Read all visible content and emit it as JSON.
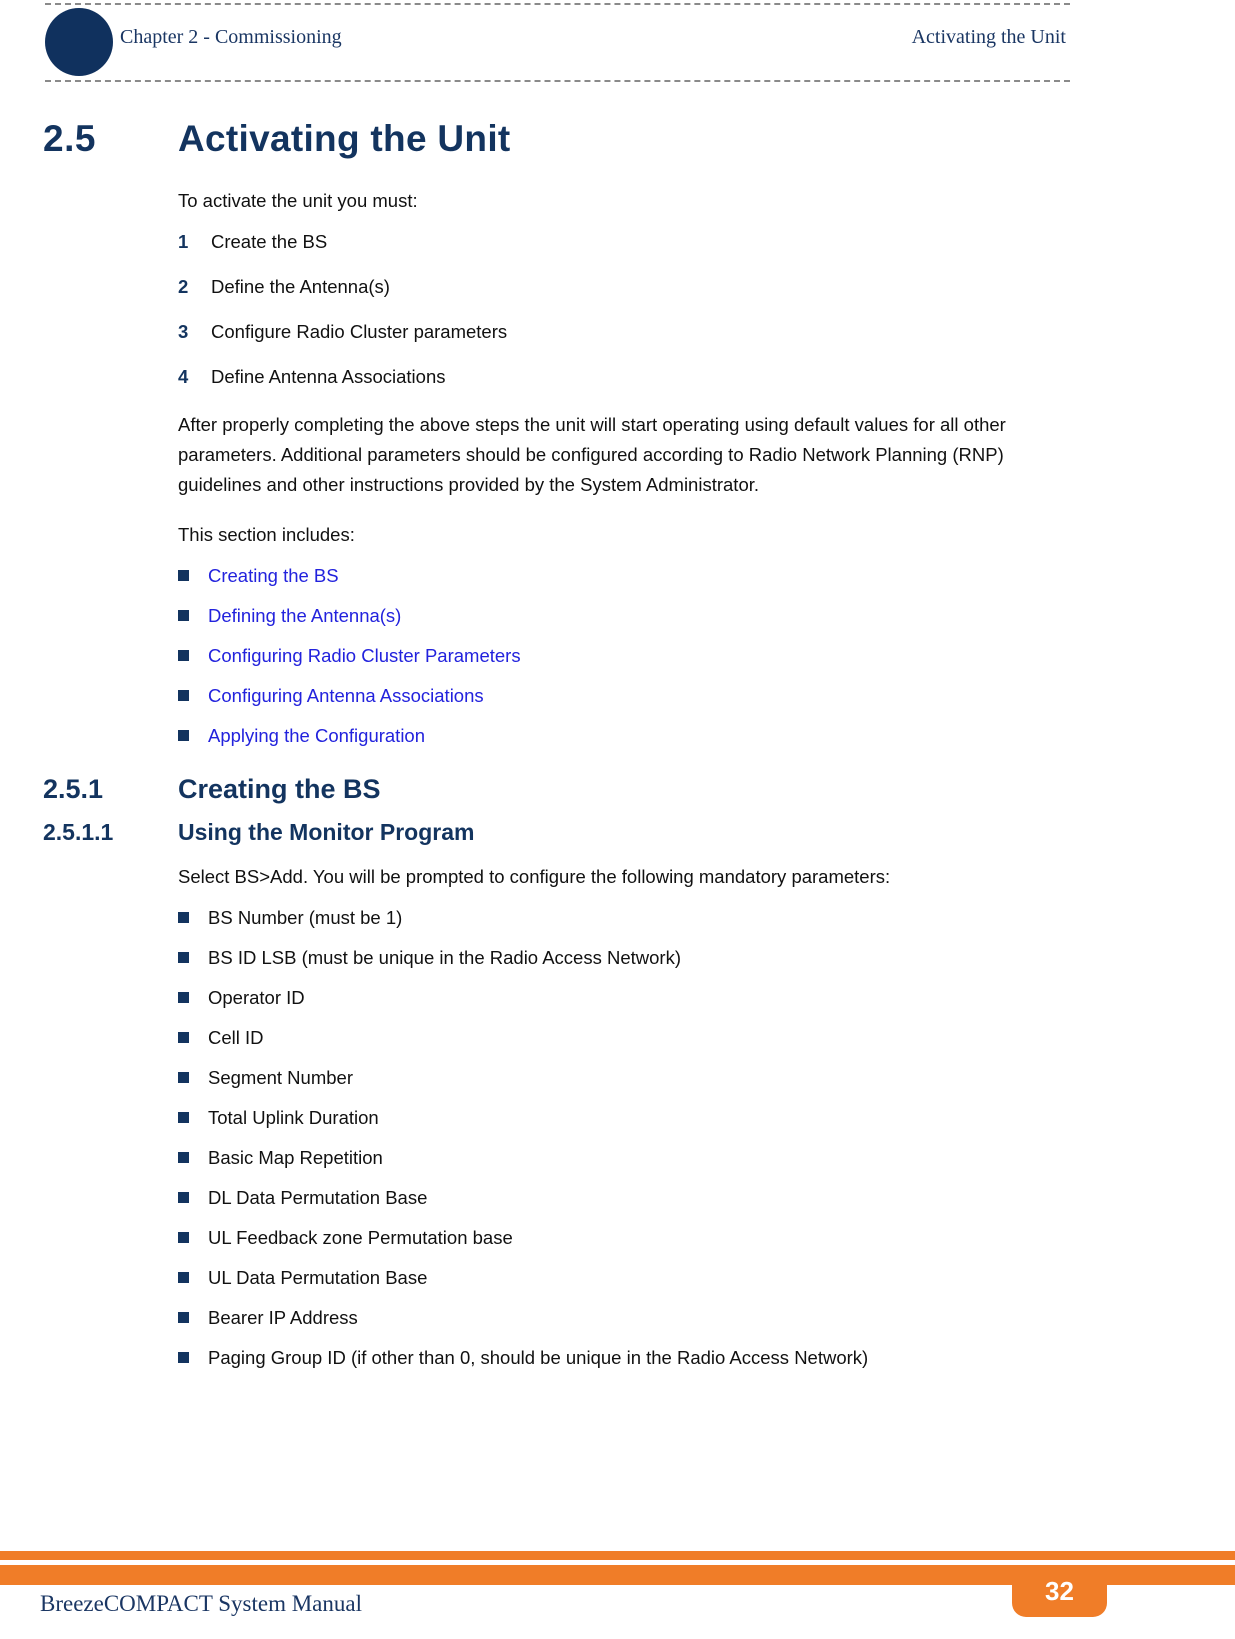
{
  "header": {
    "chapter": "Chapter 2 - Commissioning",
    "section": "Activating the Unit",
    "circle_icon": "filled-circle-icon"
  },
  "colors": {
    "heading_navy": "#13345f",
    "link_blue": "#2222dd",
    "accent_orange": "#f07d28",
    "body_black": "#111111",
    "header_serif_navy": "#1a3663"
  },
  "main": {
    "h1": {
      "number": "2.5",
      "title": "Activating the Unit"
    },
    "intro": "To activate the unit you must:",
    "steps": [
      {
        "number": "1",
        "text": "Create the BS"
      },
      {
        "number": "2",
        "text": "Define the Antenna(s)"
      },
      {
        "number": "3",
        "text": "Configure Radio Cluster parameters"
      },
      {
        "number": "4",
        "text": "Define Antenna Associations"
      }
    ],
    "paragraph": "After properly completing the above steps the unit will start operating using default values for all other parameters. Additional parameters should be configured according to Radio Network Planning (RNP) guidelines and other instructions provided by the System Administrator.",
    "includes_label": "This section includes:",
    "section_links": [
      "Creating the BS",
      "Defining the Antenna(s)",
      "Configuring Radio Cluster Parameters",
      "Configuring Antenna Associations",
      "Applying the Configuration"
    ],
    "h2": {
      "number": "2.5.1",
      "title": "Creating the BS"
    },
    "h3": {
      "number": "2.5.1.1",
      "title": "Using the Monitor Program"
    },
    "monitor_intro": "Select BS>Add. You will be prompted to configure the following mandatory parameters:",
    "parameters": [
      "BS Number (must be 1)",
      "BS ID LSB (must be unique in the Radio Access Network)",
      "Operator ID",
      "Cell ID",
      "Segment Number",
      "Total Uplink Duration",
      "Basic Map Repetition",
      "DL Data Permutation Base",
      "UL Feedback zone Permutation base",
      "UL Data Permutation Base",
      "Bearer IP Address",
      "Paging Group ID (if other than 0, should be unique in the Radio Access Network)"
    ]
  },
  "footer": {
    "manual_title": "BreezeCOMPACT System Manual",
    "page_number": "32"
  }
}
